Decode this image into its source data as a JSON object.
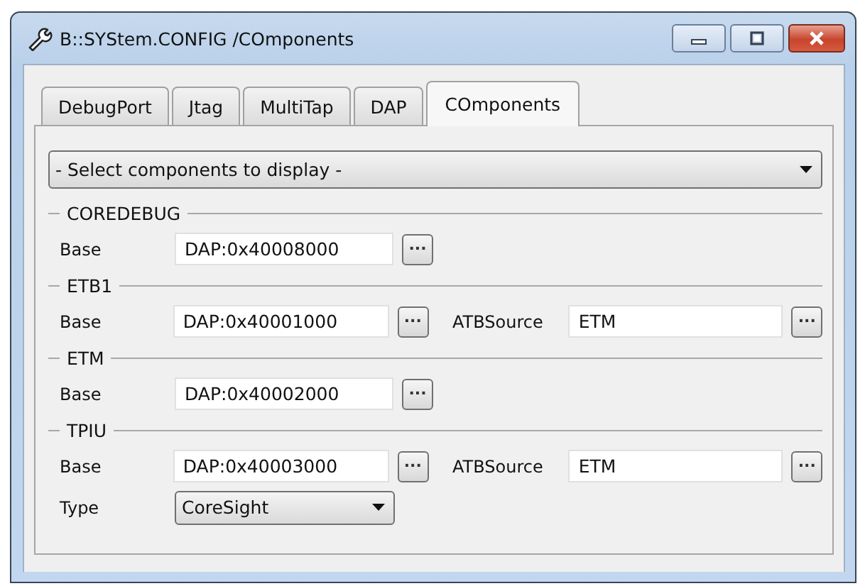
{
  "window": {
    "title": "B::SYStem.CONFIG /COmponents"
  },
  "tabs": [
    {
      "label": "DebugPort",
      "selected": false
    },
    {
      "label": "Jtag",
      "selected": false
    },
    {
      "label": "MultiTap",
      "selected": false
    },
    {
      "label": "DAP",
      "selected": false
    },
    {
      "label": "COmponents",
      "selected": true
    }
  ],
  "filter": {
    "value": "- Select components to display -"
  },
  "components": [
    {
      "name": "COREDEBUG",
      "rows": [
        {
          "kind": "address",
          "label": "Base",
          "value": "DAP:0x40008000",
          "button": "..."
        }
      ]
    },
    {
      "name": "ETB1",
      "rows": [
        {
          "kind": "address",
          "label": "Base",
          "value": "DAP:0x40001000",
          "button": "...",
          "extra": {
            "label": "ATBSource",
            "value": "ETM",
            "button": "..."
          }
        }
      ]
    },
    {
      "name": "ETM",
      "rows": [
        {
          "kind": "address",
          "label": "Base",
          "value": "DAP:0x40002000",
          "button": "..."
        }
      ]
    },
    {
      "name": "TPIU",
      "rows": [
        {
          "kind": "address",
          "label": "Base",
          "value": "DAP:0x40003000",
          "button": "...",
          "extra": {
            "label": "ATBSource",
            "value": "ETM",
            "button": "..."
          }
        },
        {
          "kind": "select",
          "label": "Type",
          "value": "CoreSight"
        }
      ]
    }
  ]
}
